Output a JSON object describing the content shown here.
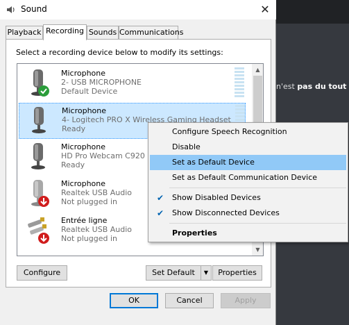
{
  "window": {
    "title": "Sound",
    "close": "✕"
  },
  "background_app": {
    "snippet_normal": "n'est ",
    "snippet_bold": "pas du tout"
  },
  "tabs": [
    {
      "label": "Playback",
      "active": false
    },
    {
      "label": "Recording",
      "active": true
    },
    {
      "label": "Sounds",
      "active": false
    },
    {
      "label": "Communications",
      "active": false
    }
  ],
  "instruction": "Select a recording device below to modify its settings:",
  "devices": [
    {
      "name": "Microphone",
      "sub": "2- USB MICROPHONE",
      "status": "Default Device",
      "badge": "check"
    },
    {
      "name": "Microphone",
      "sub": "4- Logitech PRO X Wireless Gaming Headset",
      "status": "Ready",
      "badge": "none"
    },
    {
      "name": "Microphone",
      "sub": "HD Pro Webcam C920",
      "status": "Ready",
      "badge": "none"
    },
    {
      "name": "Microphone",
      "sub": "Realtek USB Audio",
      "status": "Not plugged in",
      "badge": "down"
    },
    {
      "name": "Entrée ligne",
      "sub": "Realtek USB Audio",
      "status": "Not plugged in",
      "badge": "down"
    }
  ],
  "buttons": {
    "configure": "Configure",
    "set_default": "Set Default",
    "properties": "Properties",
    "ok": "OK",
    "cancel": "Cancel",
    "apply": "Apply"
  },
  "context_menu": {
    "items": [
      {
        "label": "Configure Speech Recognition"
      },
      {
        "label": "Disable"
      },
      {
        "label": "Set as Default Device"
      },
      {
        "label": "Set as Default Communication Device"
      },
      {
        "label": "Show Disabled Devices",
        "checked": true
      },
      {
        "label": "Show Disconnected Devices",
        "checked": true
      },
      {
        "label": "Properties"
      }
    ],
    "check_glyph": "✔"
  },
  "colors": {
    "accent": "#0078d7",
    "selection": "#cce8ff",
    "menu_hover": "#91c9f7",
    "badge_green": "#2a9d3a",
    "badge_red": "#d01c1c"
  }
}
